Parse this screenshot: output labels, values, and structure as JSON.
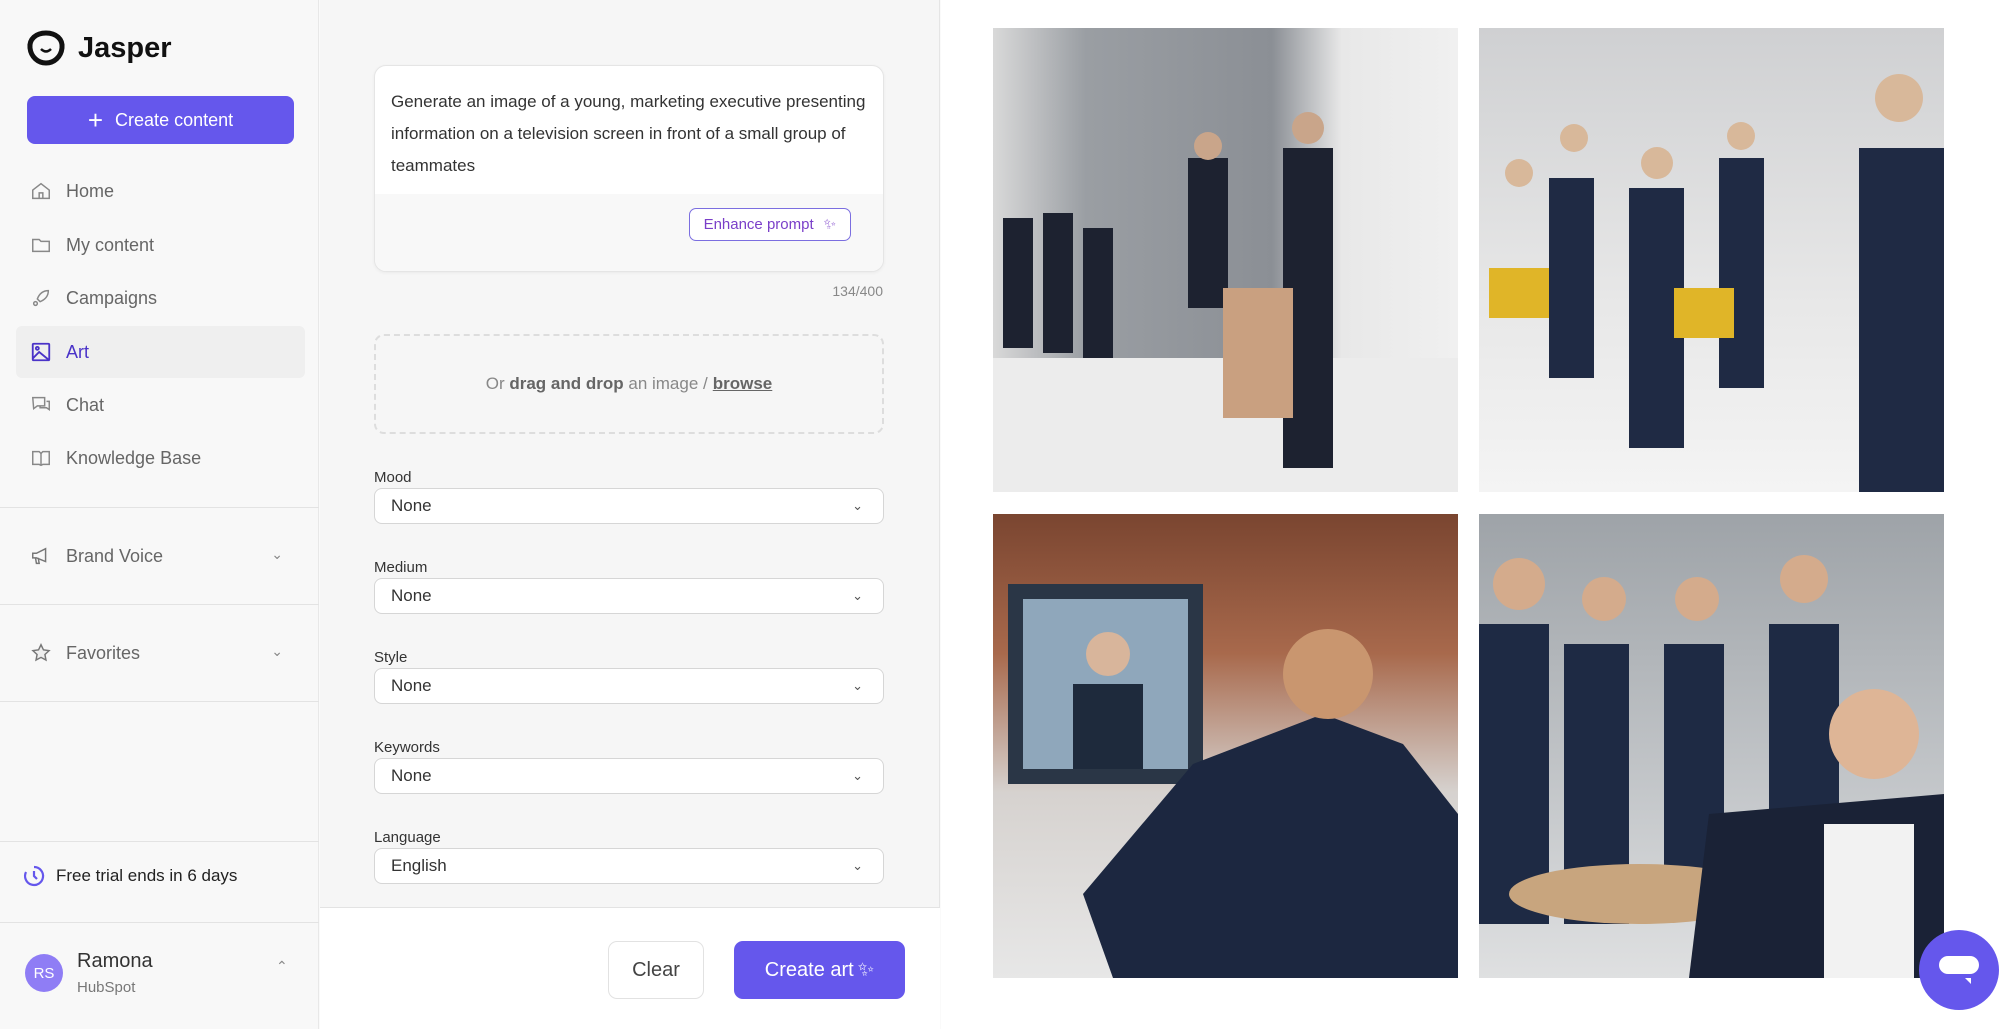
{
  "brand": {
    "name": "Jasper"
  },
  "sidebar": {
    "create_label": "Create content",
    "items": [
      {
        "label": "Home",
        "icon": "home-icon"
      },
      {
        "label": "My content",
        "icon": "folder-icon"
      },
      {
        "label": "Campaigns",
        "icon": "rocket-icon"
      },
      {
        "label": "Art",
        "icon": "image-icon",
        "active": true
      },
      {
        "label": "Chat",
        "icon": "chat-icon"
      },
      {
        "label": "Knowledge Base",
        "icon": "book-icon"
      }
    ],
    "sections": [
      {
        "label": "Brand Voice",
        "icon": "megaphone-icon"
      },
      {
        "label": "Favorites",
        "icon": "star-icon"
      }
    ],
    "trial": "Free trial ends in 6 days",
    "user": {
      "initials": "RS",
      "name": "Ramona",
      "org": "HubSpot"
    }
  },
  "form": {
    "prompt": "Generate an image of a young, marketing executive presenting information on a television screen in front of a small group of teammates",
    "enhance_label": "Enhance prompt",
    "counter": "134/400",
    "drop": {
      "prefix": "Or",
      "bold": "drag and drop",
      "middle": "an image /",
      "link": "browse"
    },
    "fields": [
      {
        "label": "Mood",
        "value": "None"
      },
      {
        "label": "Medium",
        "value": "None"
      },
      {
        "label": "Style",
        "value": "None"
      },
      {
        "label": "Keywords",
        "value": "None"
      },
      {
        "label": "Language",
        "value": "English"
      }
    ],
    "clear_label": "Clear",
    "create_label": "Create art"
  },
  "colors": {
    "accent": "#6557ec",
    "active_text": "#4a33c8"
  }
}
